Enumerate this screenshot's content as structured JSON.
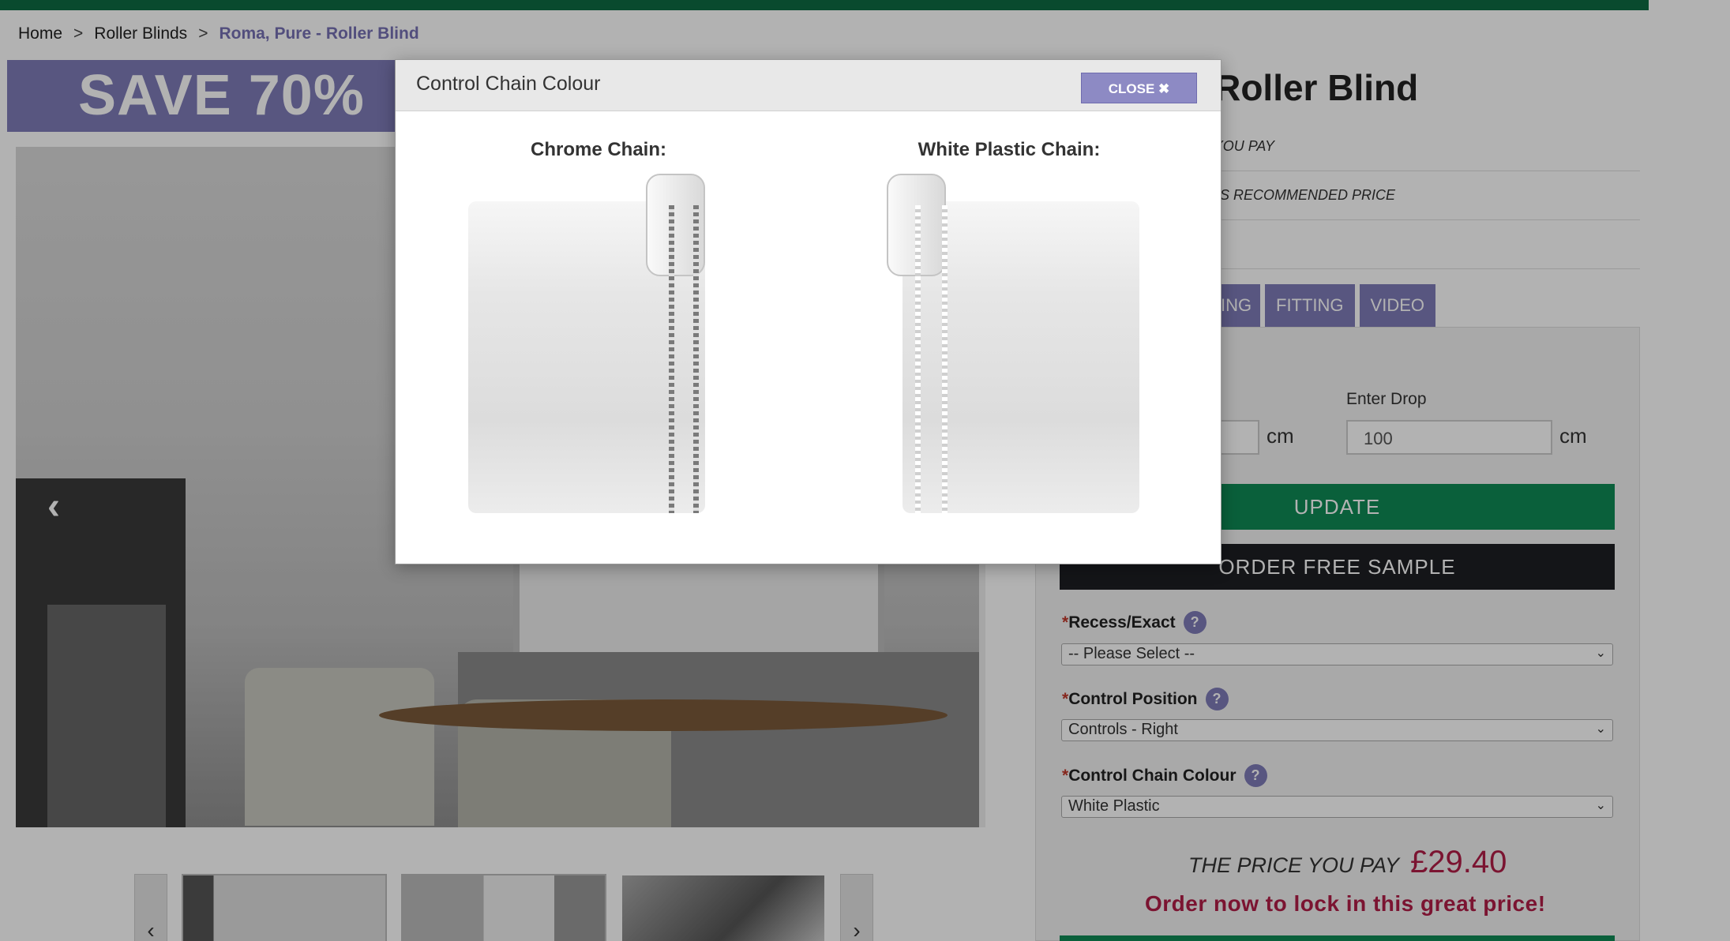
{
  "breadcrumb": {
    "items": [
      "Home",
      "Roller Blinds",
      "Roma, Pure - Roller Blind"
    ],
    "separator": ">"
  },
  "gallery": {
    "save_banner": "SAVE 70%",
    "prev_arrow": "‹"
  },
  "product": {
    "title_visible": "- Roller Blind",
    "price_row_1": "E YOU PAY",
    "price_row_2": "ERS RECOMMENDED PRICE"
  },
  "tabs": [
    {
      "label": "ING"
    },
    {
      "label": "FITTING"
    },
    {
      "label": "VIDEO"
    }
  ],
  "measure": {
    "drop_label": "Enter Drop",
    "drop_value": "100",
    "unit": "cm"
  },
  "buttons": {
    "update": "UPDATE",
    "sample": "ORDER FREE SAMPLE"
  },
  "options": [
    {
      "label": "Recess/Exact",
      "value": "-- Please Select --"
    },
    {
      "label": "Control Position",
      "value": "Controls - Right"
    },
    {
      "label": "Control Chain Colour",
      "value": "White Plastic"
    }
  ],
  "pricing": {
    "label": "THE PRICE YOU PAY",
    "amount": "£29.40",
    "cta": "Order now to lock in this great price!"
  },
  "modal": {
    "title": "Control Chain Colour",
    "close_label": "CLOSE ✖",
    "chains": [
      {
        "caption": "Chrome Chain:"
      },
      {
        "caption": "White Plastic Chain:"
      }
    ]
  },
  "colors": {
    "brand_green": "#0f8a55",
    "accent_purple": "#7e7bb8",
    "price_red": "#b01d47"
  }
}
